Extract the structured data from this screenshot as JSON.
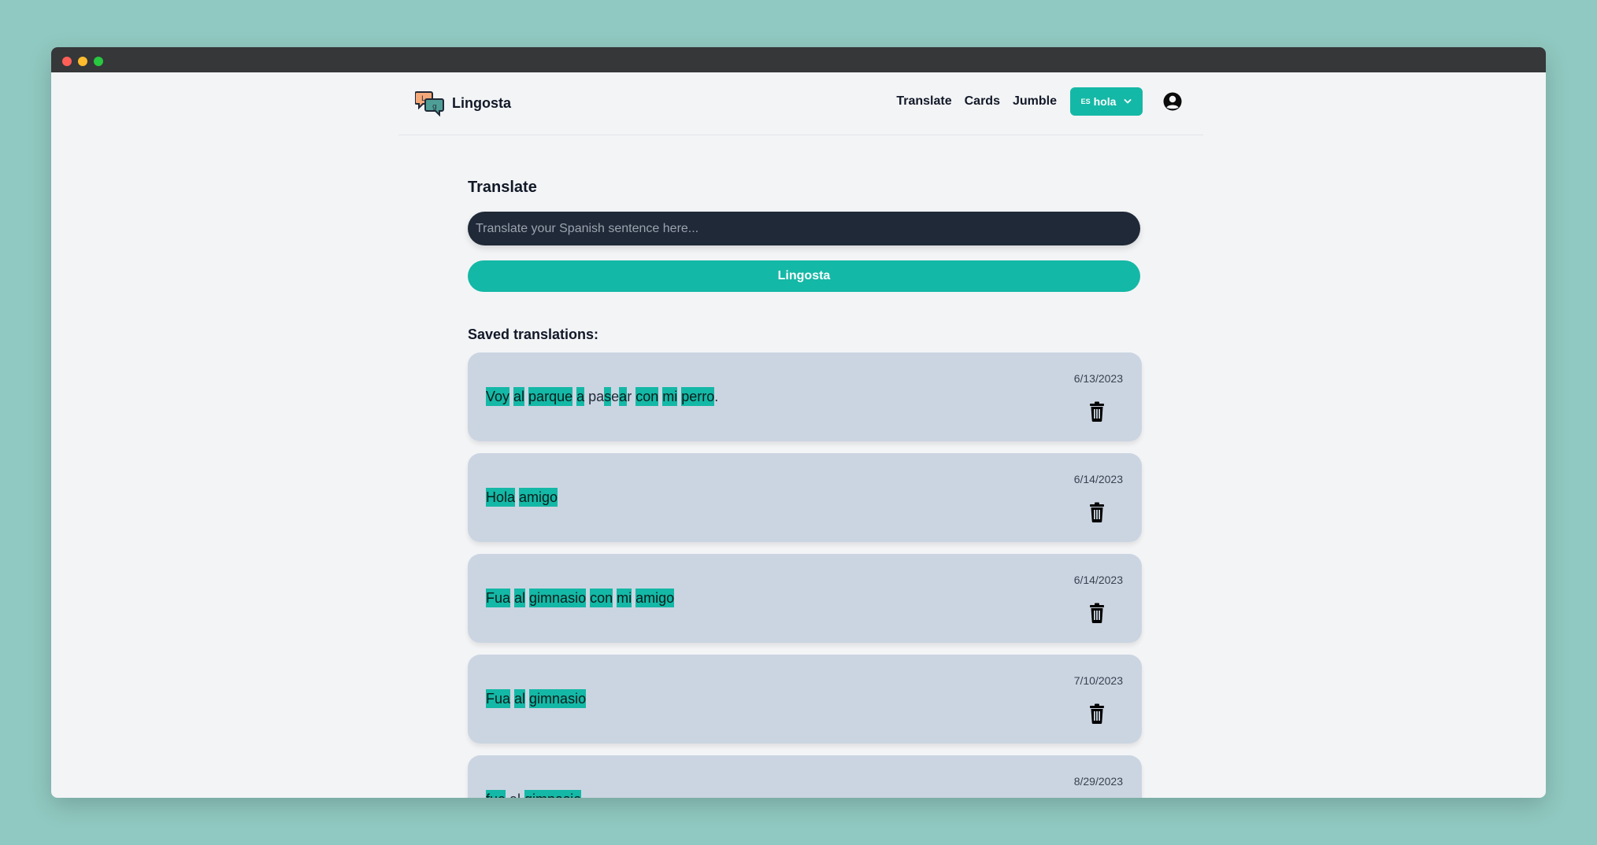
{
  "nav": {
    "logo_text": "Lingosta",
    "links": [
      "Translate",
      "Cards",
      "Jumble"
    ],
    "lang_code": "ES",
    "lang_word": "hola"
  },
  "main": {
    "title": "Translate",
    "input_placeholder": "Translate your Spanish sentence here...",
    "submit_label": "Lingosta",
    "saved_title": "Saved translations:"
  },
  "saved": [
    {
      "date": "6/13/2023",
      "tokens": [
        {
          "t": "Voy",
          "hl": true
        },
        {
          "sp": true
        },
        {
          "t": "al",
          "hl": true
        },
        {
          "sp": true
        },
        {
          "t": "parque",
          "hl": true
        },
        {
          "sp": true
        },
        {
          "t": "a",
          "hl": true
        },
        {
          "sp": true
        },
        {
          "t": "pa",
          "hl": false
        },
        {
          "t": "s",
          "hl": true
        },
        {
          "t": "e",
          "hl": false
        },
        {
          "t": "a",
          "hl": true
        },
        {
          "t": "r",
          "hl": false
        },
        {
          "sp": true
        },
        {
          "t": "con",
          "hl": true
        },
        {
          "sp": true
        },
        {
          "t": "mi",
          "hl": true
        },
        {
          "sp": true
        },
        {
          "t": "perro",
          "hl": true
        },
        {
          "t": ".",
          "hl": false
        }
      ]
    },
    {
      "date": "6/14/2023",
      "tokens": [
        {
          "t": "Hola",
          "hl": true
        },
        {
          "sp": true
        },
        {
          "t": "amigo",
          "hl": true
        }
      ]
    },
    {
      "date": "6/14/2023",
      "tokens": [
        {
          "t": "Fua",
          "hl": true
        },
        {
          "sp": true
        },
        {
          "t": "al",
          "hl": true
        },
        {
          "sp": true
        },
        {
          "t": "gimnasio",
          "hl": true
        },
        {
          "sp": true
        },
        {
          "t": "con",
          "hl": true
        },
        {
          "sp": true
        },
        {
          "t": "mi",
          "hl": true
        },
        {
          "sp": true
        },
        {
          "t": "amigo",
          "hl": true
        }
      ]
    },
    {
      "date": "7/10/2023",
      "tokens": [
        {
          "t": "Fua",
          "hl": true
        },
        {
          "sp": true
        },
        {
          "t": "al",
          "hl": true
        },
        {
          "sp": true
        },
        {
          "t": "gimnasio",
          "hl": true
        }
      ]
    },
    {
      "date": "8/29/2023",
      "tokens": [
        {
          "t": "fue",
          "hl": true
        },
        {
          "sp": true
        },
        {
          "t": "al",
          "hl": false
        },
        {
          "sp": true
        },
        {
          "t": "gimnasio",
          "hl": true
        }
      ]
    }
  ],
  "colors": {
    "accent": "#14b8a6",
    "card_bg": "#cbd5e1",
    "input_bg": "#1f2937",
    "page_bg": "#f3f4f6",
    "backdrop": "#90c9c1"
  }
}
